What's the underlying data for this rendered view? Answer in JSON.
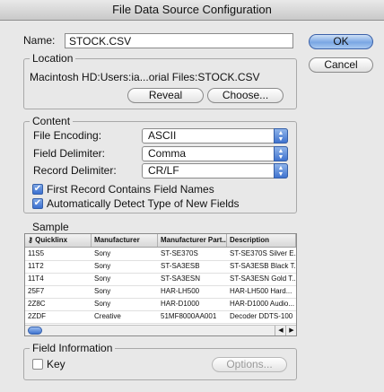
{
  "window": {
    "title": "File Data Source Configuration"
  },
  "name": {
    "label": "Name:",
    "value": "STOCK.CSV"
  },
  "buttons": {
    "ok": "OK",
    "cancel": "Cancel",
    "reveal": "Reveal",
    "choose": "Choose...",
    "options": "Options..."
  },
  "location": {
    "legend": "Location",
    "path": "Macintosh HD:Users:ia...orial Files:STOCK.CSV"
  },
  "content": {
    "legend": "Content",
    "file_encoding_label": "File Encoding:",
    "file_encoding_value": "ASCII",
    "field_delimiter_label": "Field Delimiter:",
    "field_delimiter_value": "Comma",
    "record_delimiter_label": "Record Delimiter:",
    "record_delimiter_value": "CR/LF",
    "first_record_label": "First Record Contains Field Names",
    "first_record_checked": true,
    "auto_detect_label": "Automatically Detect Type of New Fields",
    "auto_detect_checked": true
  },
  "sample": {
    "label": "Sample",
    "columns": [
      "Quicklinx",
      "Manufacturer",
      "Manufacturer Part...",
      "Description"
    ],
    "rows": [
      [
        "11S5",
        "Sony",
        "ST-SE370S",
        "ST-SE370S Silver E..."
      ],
      [
        "11T2",
        "Sony",
        "ST-SA3ESB",
        "ST-SA3ESB Black T..."
      ],
      [
        "11T4",
        "Sony",
        "ST-SA3ESN",
        "ST-SA3ESN Gold T..."
      ],
      [
        "25F7",
        "Sony",
        "HAR-LH500",
        "HAR-LH500 Hard..."
      ],
      [
        "2Z8C",
        "Sony",
        "HAR-D1000",
        "HAR-D1000 Audio..."
      ],
      [
        "2ZDF",
        "Creative",
        "51MF8000AA001",
        "Decoder DDTS-100"
      ]
    ]
  },
  "field_info": {
    "legend": "Field Information",
    "key_label": "Key",
    "key_checked": false
  },
  "icons": {
    "key": "key-icon",
    "scroll_left": "scroll-left-arrow-icon",
    "scroll_right": "scroll-right-arrow-icon",
    "popup": "popup-arrows-icon",
    "check": "checkmark-icon"
  },
  "colors": {
    "accent": "#3f73cf",
    "window_bg": "#e8e8e8"
  }
}
